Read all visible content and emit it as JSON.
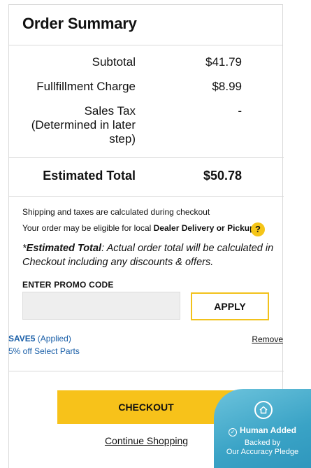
{
  "summary": {
    "title": "Order Summary",
    "rows": [
      {
        "label": "Subtotal",
        "value": "$41.79"
      },
      {
        "label": "Fullfillment Charge",
        "value": "$8.99"
      },
      {
        "label_line1": "Sales Tax",
        "label_line2": "(Determined in later",
        "label_line3": "step)",
        "value": "-"
      }
    ],
    "total_label": "Estimated Total",
    "total_value": "$50.78"
  },
  "info": {
    "shipping_note": "Shipping and taxes are calculated during checkout",
    "dealer_prefix": "Your order may be eligible for local ",
    "dealer_bold": "Dealer Delivery or Pickup.",
    "help_glyph": "?",
    "est_asterisk": "*",
    "est_bold": "Estimated Total",
    "est_rest": ": Actual order total will be calculated in Checkout including any discounts & offers."
  },
  "promo": {
    "label": "ENTER PROMO CODE",
    "input_value": "",
    "input_placeholder": "",
    "apply_label": "APPLY",
    "applied_code": "SAVE5",
    "applied_status": " (Applied)",
    "applied_desc": "5% off Select Parts",
    "remove_label": "Remove"
  },
  "actions": {
    "checkout_label": "CHECKOUT",
    "continue_label": "Continue Shopping"
  },
  "badge": {
    "title": "Human Added",
    "line1": "Backed by",
    "line2": "Our Accuracy Pledge",
    "icon": "home-icon"
  },
  "colors": {
    "accent_yellow": "#f7c21a",
    "link_blue": "#1a5fa8",
    "badge_teal": "#3aa3c6"
  }
}
